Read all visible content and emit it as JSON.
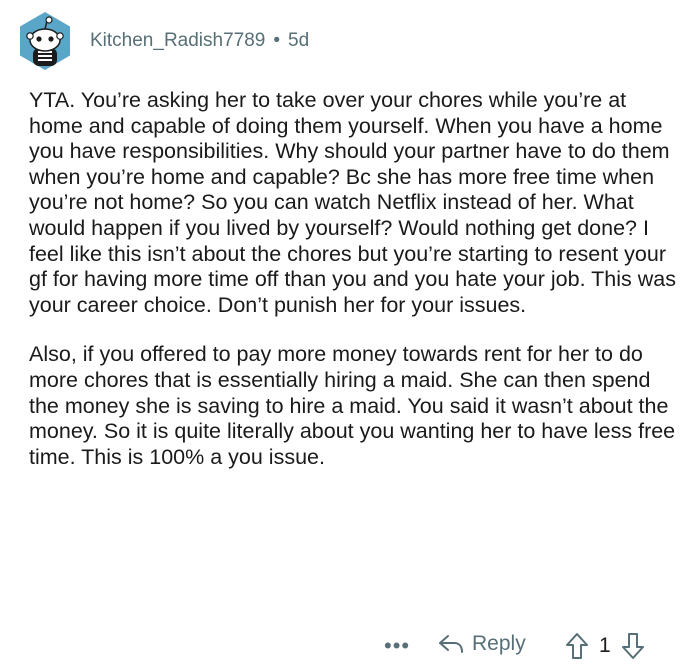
{
  "comment": {
    "username": "Kitchen_Radish7789",
    "separator": "•",
    "age": "5d",
    "paragraphs": [
      "YTA. You’re asking her to take over your chores while you’re at home and capable of doing them yourself. When you have a home you have responsibilities. Why should your partner have to do them when you’re home and capable? Bc she has more free time when you’re not home? So you can watch Netflix instead of her. What would happen if you lived by yourself? Would nothing get done? I feel like this isn’t about the chores but you’re starting to resent your gf for having more time off than you and you hate your job. This was your career choice. Don’t punish her for your issues.",
      "Also, if you offered to pay more money towards rent for her to do more chores that is essentially hiring a maid. She can then spend the money she is saving to hire a maid. You said it wasn’t about the money. So it is quite literally about you wanting her to have less free time. This is 100% a you issue."
    ]
  },
  "actions": {
    "more_label": "•••",
    "reply_label": "Reply",
    "vote_count": "1"
  },
  "icons": {
    "avatar": "snoo-skeleton-avatar",
    "reply": "reply-arrow-icon",
    "upvote": "upvote-arrow-icon",
    "downvote": "downvote-arrow-icon"
  },
  "colors": {
    "avatar_bg": "#5aa6c8",
    "meta_text": "#576f76",
    "body_text": "#1a1a1b"
  }
}
